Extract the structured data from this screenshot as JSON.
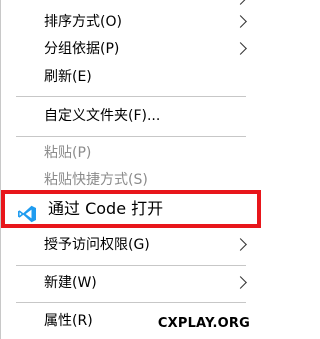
{
  "menu": {
    "items": [
      {
        "label": "",
        "submenu": true
      },
      {
        "label": "排序方式(O)",
        "submenu": true
      },
      {
        "label": "分组依据(P)",
        "submenu": true
      },
      {
        "label": "刷新(E)"
      },
      {
        "label": "自定义文件夹(F)..."
      },
      {
        "label": "粘贴(P)",
        "disabled": true
      },
      {
        "label": "粘贴快捷方式(S)",
        "disabled": true
      },
      {
        "label": "通过 Code 打开",
        "icon": "vscode-icon",
        "highlighted": true
      },
      {
        "label": "授予访问权限(G)",
        "submenu": true
      },
      {
        "label": "新建(W)",
        "submenu": true
      },
      {
        "label": "属性(R)"
      }
    ]
  },
  "watermark": "CXPLAY.ORG",
  "colors": {
    "highlight_border": "#e8161b",
    "vscode_blue": "#1f9cf0",
    "disabled_text": "#8c8c8c"
  }
}
